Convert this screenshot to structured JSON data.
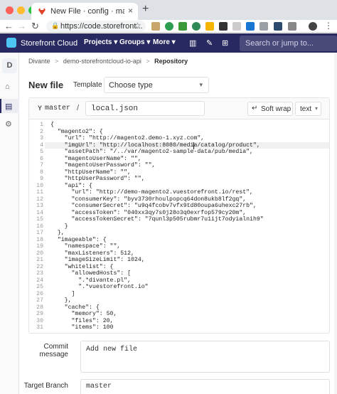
{
  "browser": {
    "tab_title": "New File · config · master · Div",
    "close_glyph": "×",
    "new_tab_glyph": "+",
    "url": "https://code.storefront...",
    "back": "←",
    "forward": "→",
    "reload": "↻",
    "star": "☆"
  },
  "navbar": {
    "brand": "Storefront Cloud",
    "projects": "Projects ▾",
    "groups": "Groups ▾",
    "more": "More ▾",
    "search_placeholder": "Search or jump to..."
  },
  "sidebar": {
    "avatar_letter": "D",
    "home_icon": "⌂",
    "repo_icon": "▤",
    "settings_icon": "⚙"
  },
  "breadcrumb": {
    "group": "Divante",
    "project": "demo-storefrontcloud-io-api",
    "current": "Repository",
    "sep": ">"
  },
  "form": {
    "title": "New file",
    "template_label": "Template",
    "template_value": "Choose type",
    "chevron": "▾"
  },
  "editor": {
    "branch_icon": "Y",
    "branch": "master",
    "slash": "/",
    "file_name": "local.json",
    "softwrap_label": "Soft wrap",
    "softwrap_icon": "↵",
    "mode_label": "text",
    "mode_chevron": "▾",
    "lines": [
      "{",
      "  \"magento2\": {",
      "    \"url\": \"http://magento2.demo-1.xyz.com\",",
      "    \"imgUrl\": \"http://localhost:8080/media/catalog/product\",",
      "    \"assetPath\": \"/../var/magento2-sample-data/pub/media\",",
      "    \"magentoUserName\": \"\",",
      "    \"magentoUserPassword\": \"\",",
      "    \"httpUserName\": \"\",",
      "    \"httpUserPassword\": \"\",",
      "    \"api\": {",
      "      \"url\": \"http://demo-magento2.vuestorefront.io/rest\",",
      "      \"consumerKey\": \"byv3730rhoulpopcq64don8ukb8lf2gq\",",
      "      \"consumerSecret\": \"u9q4fcobv7vfx9td80oupa6uhexc27rb\",",
      "      \"accessToken\": \"040xx3qy7s0j28o3q0exrfop579cy20m\",",
      "      \"accessTokenSecret\": \"7qunl3p505rubmr7u1ijt7odyialnih9\"",
      "    }",
      "  },",
      "  \"imageable\": {",
      "    \"namespace\": \"\",",
      "    \"maxListeners\": 512,",
      "    \"imageSizeLimit\": 1024,",
      "    \"whitelist\": {",
      "      \"allowedHosts\": [",
      "        \".*divante.pl\",",
      "        \".*vuestorefront.io\"",
      "      ]",
      "    },",
      "    \"cache\": {",
      "      \"memory\": 50,",
      "      \"files\": 20,",
      "      \"items\": 100"
    ],
    "highlighted_line": 4
  },
  "commit": {
    "message_label_1": "Commit",
    "message_label_2": "message",
    "message_value": "Add new file",
    "branch_label": "Target Branch",
    "branch_value": "master"
  }
}
